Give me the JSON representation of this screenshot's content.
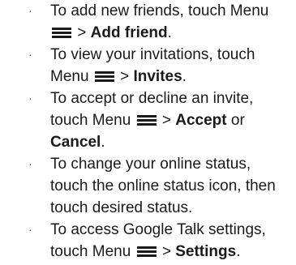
{
  "bullet": "·",
  "items": [
    {
      "lines": [
        {
          "pre": "To add new friends, touch Menu"
        },
        {
          "pre": "",
          "icon": "menu-icon",
          "mid": " > ",
          "bold1": "Add friend",
          "post": "."
        }
      ]
    },
    {
      "lines": [
        {
          "pre": "To view your invitations, touch"
        },
        {
          "pre": "Menu ",
          "icon": "menu-icon",
          "mid": " > ",
          "bold1": "Invites",
          "post": "."
        }
      ]
    },
    {
      "lines": [
        {
          "pre": "To accept or decline an invite,"
        },
        {
          "pre": "touch Menu ",
          "icon": "menu-icon",
          "mid": " > ",
          "bold1": "Accept",
          "post": " or"
        },
        {
          "bold1": "Cancel",
          "post": "."
        }
      ]
    },
    {
      "lines": [
        {
          "pre": "To change your online status,"
        },
        {
          "pre": "touch the online status icon, then"
        },
        {
          "pre": "touch desired status."
        }
      ]
    },
    {
      "lines": [
        {
          "pre": "To access Google Talk settings,"
        },
        {
          "pre": "touch Menu ",
          "icon": "menu-icon",
          "mid": " > ",
          "bold1": "Settings",
          "post": "."
        }
      ]
    }
  ]
}
